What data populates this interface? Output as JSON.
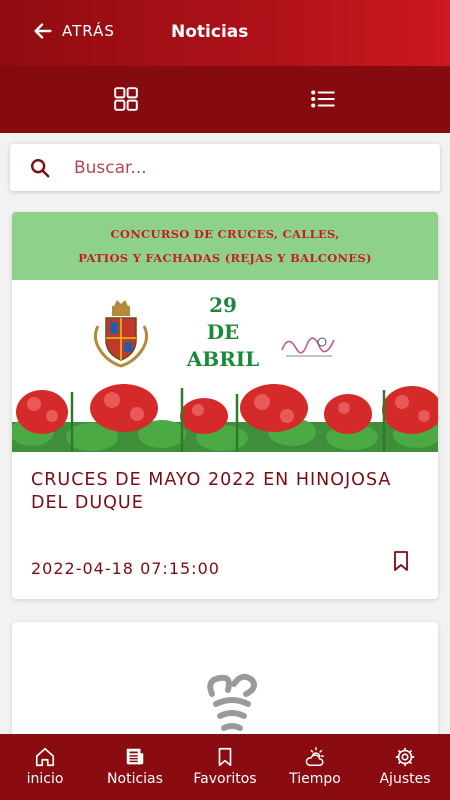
{
  "header": {
    "back_label": "ATRÁS",
    "title": "Noticias"
  },
  "view_toggle": {
    "grid_icon": "grid-icon",
    "list_icon": "list-icon"
  },
  "search": {
    "placeholder": "Buscar..."
  },
  "news": [
    {
      "banner": {
        "line1": "CONCURSO DE CRUCES, CALLES,",
        "line2": "PATIOS  Y FACHADAS (REJAS Y BALCONES)",
        "day": "29",
        "de": "DE",
        "month": "ABRIL"
      },
      "title": "CRUCES DE MAYO 2022 EN HINOJOSA DEL DUQUE",
      "date": "2022-04-18 07:15:00"
    }
  ],
  "bottom_nav": [
    {
      "label": "inicio",
      "icon": "home-icon"
    },
    {
      "label": "Noticias",
      "icon": "newspaper-icon"
    },
    {
      "label": "Favoritos",
      "icon": "bookmark-icon"
    },
    {
      "label": "Tiempo",
      "icon": "weather-icon"
    },
    {
      "label": "Ajustes",
      "icon": "gear-icon"
    }
  ],
  "colors": {
    "primary": "#8a0c10",
    "accent_text": "#7a0d14",
    "banner_green": "#8ed18a"
  }
}
